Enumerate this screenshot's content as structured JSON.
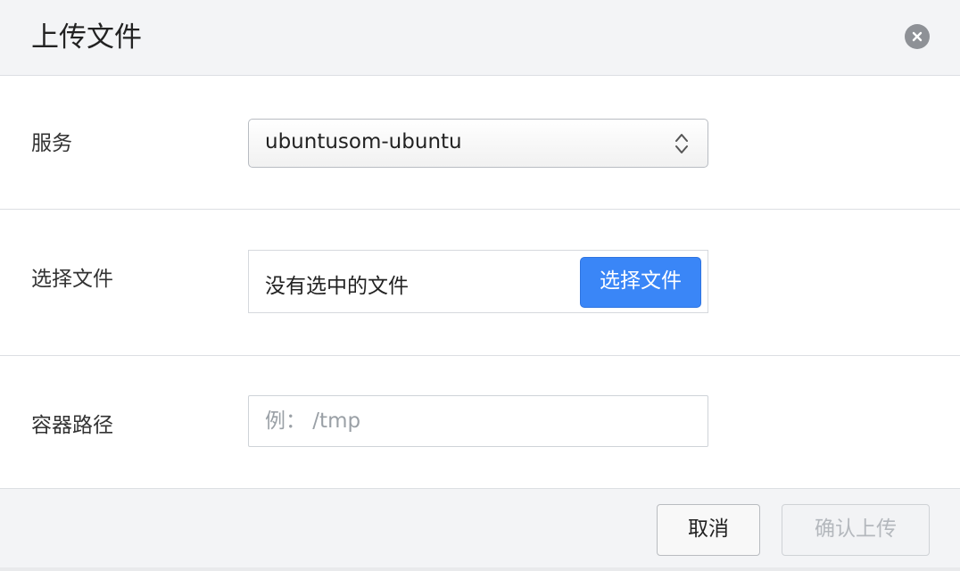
{
  "dialog": {
    "title": "上传文件",
    "close_icon": "close-icon"
  },
  "form": {
    "service": {
      "label": "服务",
      "selected_value": "ubuntusom-ubuntu"
    },
    "file": {
      "label": "选择文件",
      "status_text": "没有选中的文件",
      "button_label": "选择文件"
    },
    "container_path": {
      "label": "容器路径",
      "value": "",
      "placeholder": "例： /tmp"
    }
  },
  "footer": {
    "cancel_label": "取消",
    "confirm_label": "确认上传"
  },
  "colors": {
    "primary_button": "#3a86f7",
    "header_bg": "#f3f4f6",
    "disabled_text": "#b4b8bd"
  }
}
